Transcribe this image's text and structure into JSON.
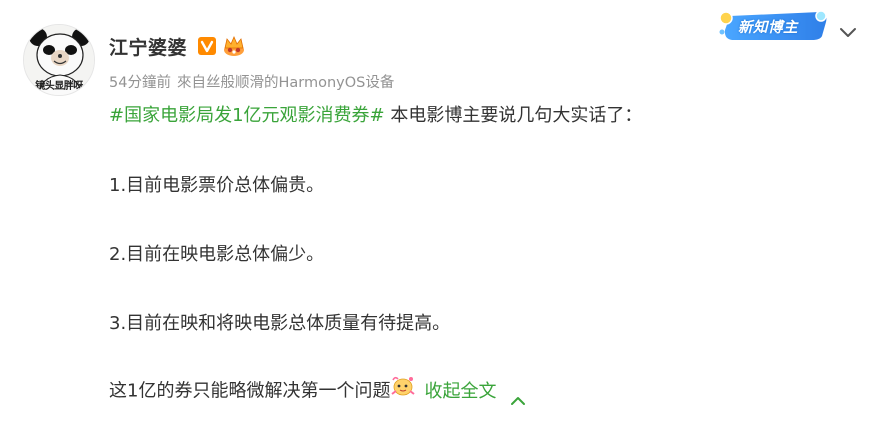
{
  "post": {
    "author": {
      "name": "江宁婆婆",
      "avatar_caption": "镜头显胖呀"
    },
    "meta": {
      "time": "54分鐘前",
      "source": "來自丝般顺滑的HarmonyOS设备"
    },
    "badge": {
      "label": "新知博主"
    },
    "content": {
      "hashtag": "#国家电影局发1亿元观影消费券#",
      "intro": " 本电影博主要说几句大实话了：",
      "point1": "1.目前电影票价总体偏贵。",
      "point2": "2.目前在映电影总体偏少。",
      "point3": "3.目前在映和将映电影总体质量有待提高。",
      "closing": "这1亿的券只能略微解决第一个问题",
      "collapse_label": "收起全文"
    },
    "icons": {
      "verified": "verified-v-icon",
      "crown": "vip-crown-icon",
      "emoji": "cute-emoji-icon",
      "more": "chevron-down-icon",
      "collapse": "chevron-up-icon"
    },
    "colors": {
      "hashtag": "#3aa43a",
      "verified": "#ff8200",
      "meta": "#939393",
      "badge": "#2f86e8"
    }
  }
}
